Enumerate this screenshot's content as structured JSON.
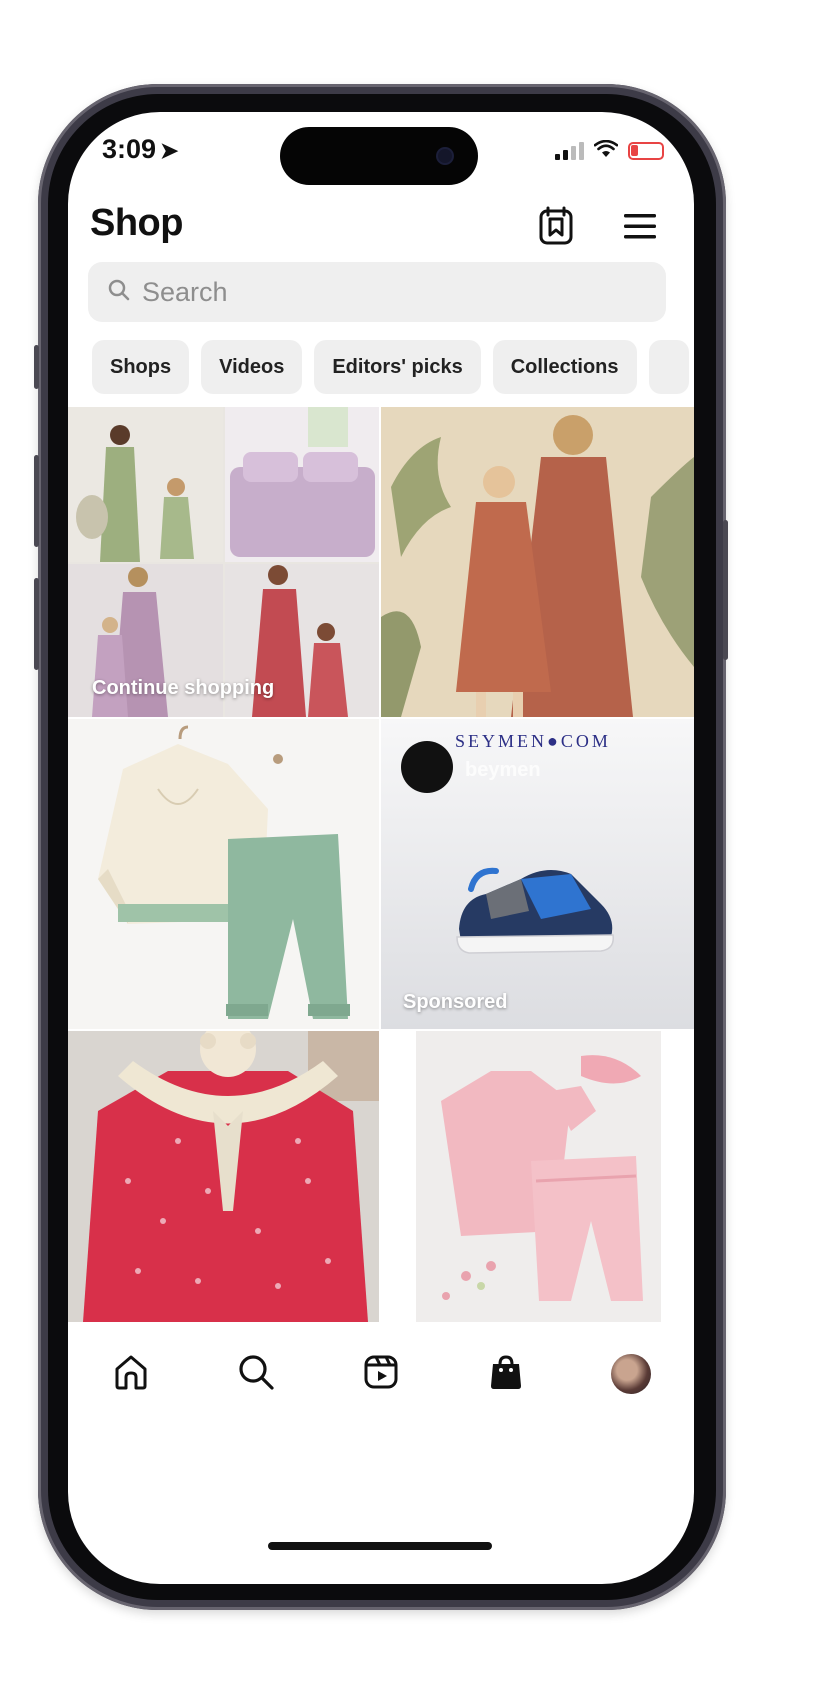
{
  "status_bar": {
    "time": "3:09",
    "location_arrow": "➤"
  },
  "header": {
    "title": "Shop"
  },
  "search": {
    "placeholder": "Search"
  },
  "chips": [
    {
      "label": "Shops"
    },
    {
      "label": "Videos"
    },
    {
      "label": "Editors' picks"
    },
    {
      "label": "Collections"
    }
  ],
  "grid": {
    "continue_label": "Continue shopping",
    "brand_name": "SEYMEN●COM",
    "account_name": "beymen",
    "sponsored_label": "Sponsored"
  },
  "icons": {
    "search": "search-icon",
    "save": "shop-saved-icon",
    "menu": "menu-icon",
    "home": "home-icon",
    "explore": "search-icon",
    "reels": "reels-icon",
    "shop": "shopping-bag-icon",
    "profile": "avatar"
  },
  "colors": {
    "battery": "#e84444",
    "chip_bg": "#efefef",
    "search_bg": "#efefef"
  }
}
